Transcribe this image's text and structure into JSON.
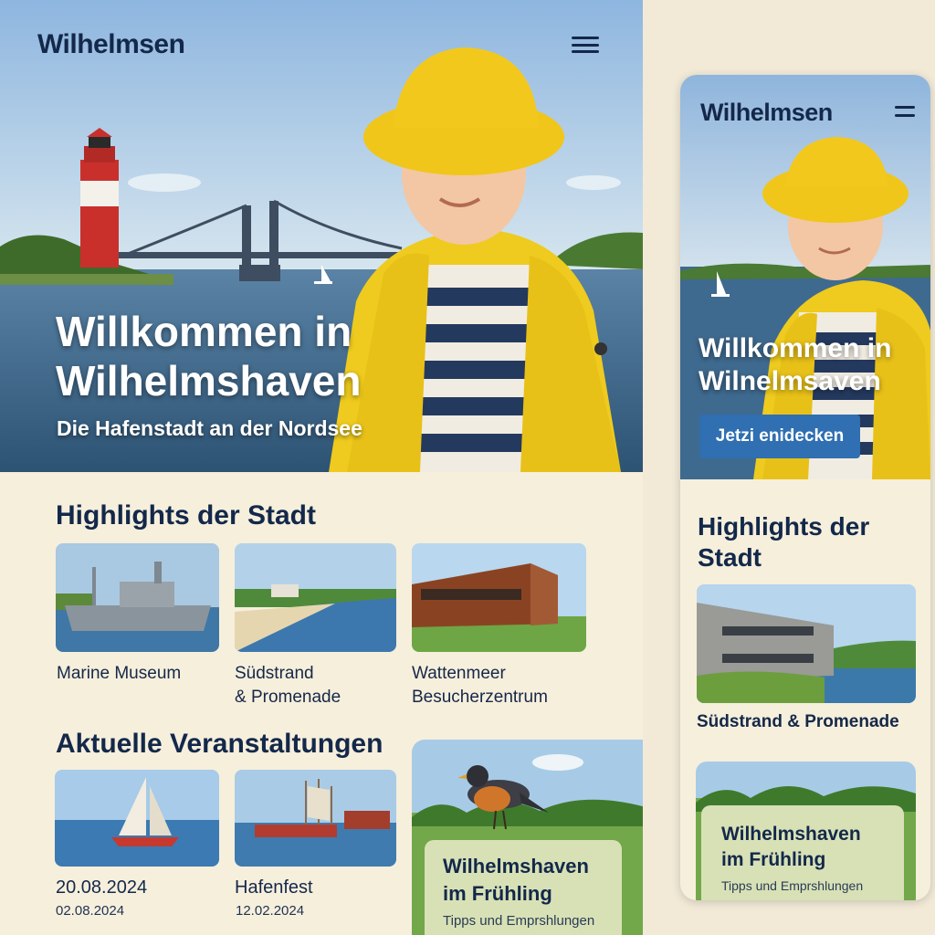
{
  "desktop": {
    "logo": "Wilhelmsen",
    "hero": {
      "title": "Willkommen in Wilhelmshaven",
      "subtitle": "Die Hafenstadt an der Nordsee"
    },
    "highlights": {
      "title": "Highlights der Stadt",
      "items": [
        {
          "label_line1": "Marine Museum",
          "label_line2": ""
        },
        {
          "label_line1": "Südstrand",
          "label_line2": "& Promenade"
        },
        {
          "label_line1": "Wattenmeer",
          "label_line2": "Besucherzentrum"
        }
      ]
    },
    "events": {
      "title": "Aktuelle Veranstaltungen",
      "items": [
        {
          "line1": "20.08.2024",
          "line2": "02.08.2024"
        },
        {
          "line1": "Hafenfest",
          "line2": "12.02.2024"
        }
      ]
    },
    "feature": {
      "title": "Wilhelmshaven im Frühling",
      "subtitle": "Tipps und Emprshlungen"
    }
  },
  "mobile": {
    "logo": "Wilhelmsen",
    "hero": {
      "title": "Willkommen in Wilnelmsaven",
      "cta": "Jetzi enidecken"
    },
    "highlights": {
      "title": "Highlights der Stadt",
      "card_label": "Südstrand & Promenade"
    },
    "feature": {
      "title": "Wilhelmshaven im Frühling",
      "subtitle": "Tipps und Emprshlungen"
    }
  },
  "colors": {
    "navy": "#13284a",
    "cream": "#f6efdc",
    "yellow": "#f2c21b",
    "cta_blue": "#2f6fb2",
    "feature_green": "#d8e1b6"
  },
  "icons": [
    "menu-icon"
  ]
}
